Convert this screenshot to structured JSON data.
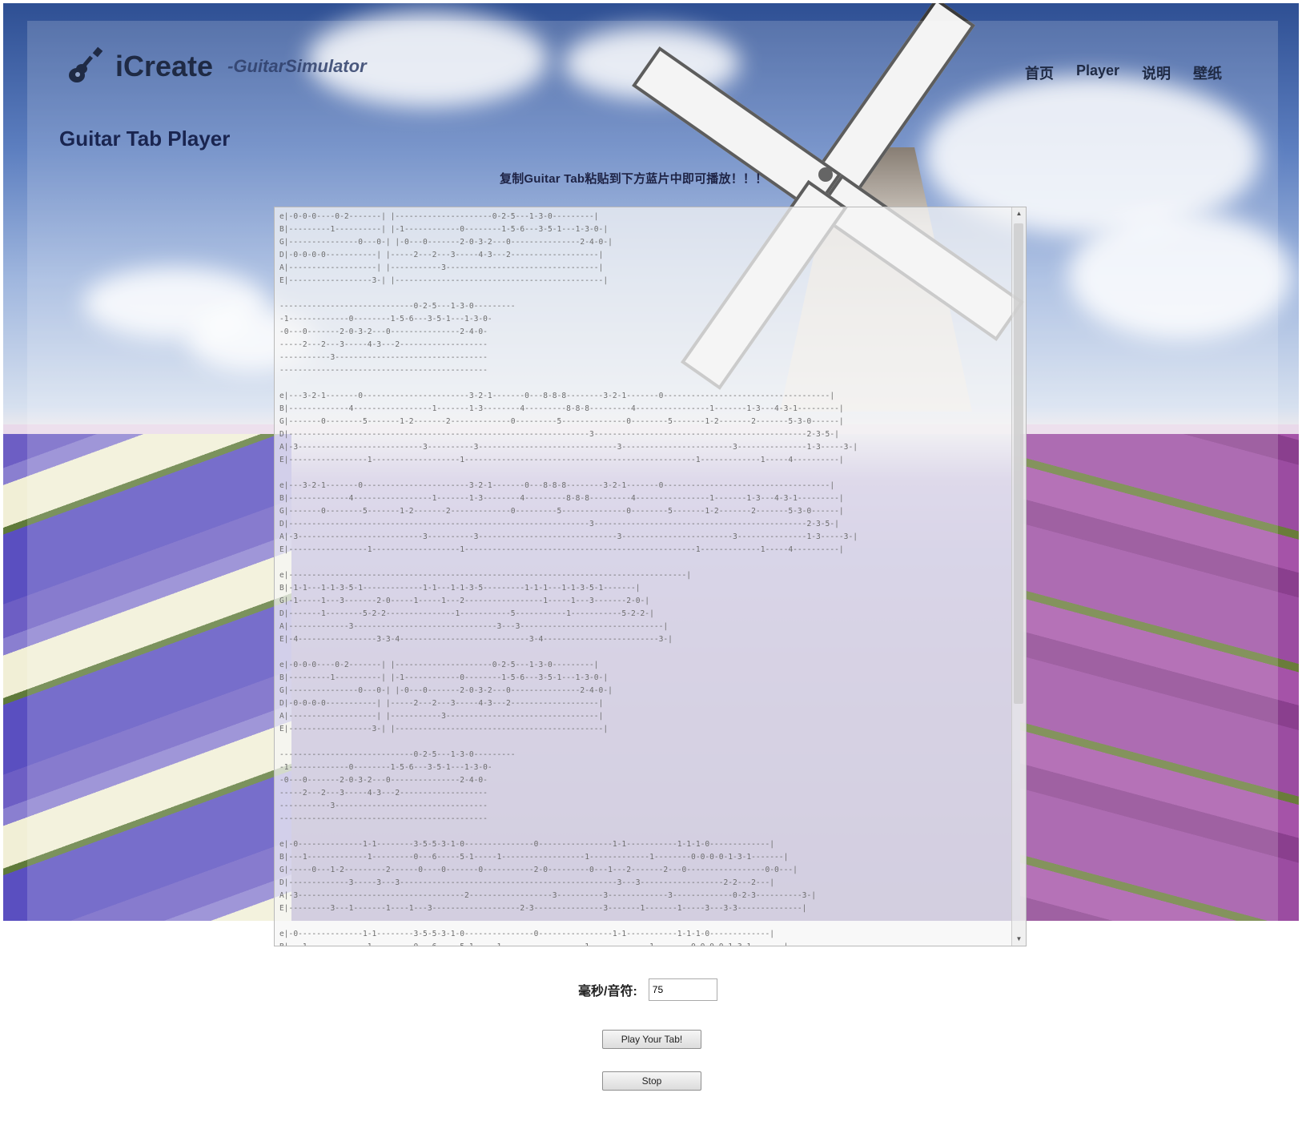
{
  "header": {
    "logo_title": "iCreate",
    "logo_subtitle": "-GuitarSimulator",
    "logo_icon": "guitar-icon"
  },
  "nav": {
    "items": [
      {
        "label": "首页"
      },
      {
        "label": "Player"
      },
      {
        "label": "说明"
      },
      {
        "label": "壁纸"
      }
    ]
  },
  "main": {
    "page_title": "Guitar Tab Player",
    "instruction": "复制Guitar Tab粘贴到下方蓝片中即可播放！！！",
    "tab_text": "e|-0-0-0----0-2-------| |---------------------0-2-5---1-3-0---------|\nB|---------1----------| |-1------------0--------1-5-6---3-5-1---1-3-0-|\nG|---------------0---0-| |-0---0-------2-0-3-2---0---------------2-4-0-|\nD|-0-0-0-0-----------| |-----2---2---3-----4-3---2-------------------|\nA|-------------------| |-----------3---------------------------------|\nE|------------------3-| |---------------------------------------------|\n\n-----------------------------0-2-5---1-3-0---------\n-1-------------0--------1-5-6---3-5-1---1-3-0-\n-0---0-------2-0-3-2---0---------------2-4-0-\n-----2---2---3-----4-3---2-------------------\n-----------3---------------------------------\n---------------------------------------------\n\ne|---3-2-1-------0-----------------------3-2-1-------0---8-8-8--------3-2-1-------0------------------------------------|\nB|-------------4-----------------1-------1-3--------4---------8-8-8---------4----------------1-------1-3---4-3-1---------|\nG|-------0--------5-------1-2-------2-------------0---------5--------------0--------5-------1-2-------2-------5-3-0------|\nD|-----------------------------------------------------------------3----------------------------------------------2-3-5-|\nA|-3---------------------------3----------3------------------------------3------------------------3---------------1-3-----3-|\nE|-----------------1-------------------1--------------------------------------------------1-------------1-----4----------|\n\ne|---3-2-1-------0-----------------------3-2-1-------0---8-8-8--------3-2-1-------0------------------------------------|\nB|-------------4-----------------1-------1-3--------4---------8-8-8---------4----------------1-------1-3---4-3-1---------|\nG|-------0--------5-------1-2-------2-------------0---------5--------------0--------5-------1-2-------2-------5-3-0------|\nD|-----------------------------------------------------------------3----------------------------------------------2-3-5-|\nA|-3---------------------------3----------3------------------------------3------------------------3---------------1-3-----3-|\nE|-----------------1-------------------1--------------------------------------------------1-------------1-----4----------|\n\ne|--------------------------------------------------------------------------------------|\nB|-1-1---1-1-3-5-1-------------1-1---1-1-3-5---------1-1-1---1-1-3-5-1-------|\nG|-1-----1---3-------2-0-----1-----1---2-----------------1-----1---3-------2-0-|\nD|-------1--------5-2-2---------------1-----------5-----------1-----------5-2-2-|\nA|-------------3-------------------------------3---3-------------------------------|\nE|-4-----------------3-3-4----------------------------3-4-------------------------3-|\n\ne|-0-0-0----0-2-------| |---------------------0-2-5---1-3-0---------|\nB|---------1----------| |-1------------0--------1-5-6---3-5-1---1-3-0-|\nG|---------------0---0-| |-0---0-------2-0-3-2---0---------------2-4-0-|\nD|-0-0-0-0-----------| |-----2---2---3-----4-3---2-------------------|\nA|-------------------| |-----------3---------------------------------|\nE|------------------3-| |---------------------------------------------|\n\n-----------------------------0-2-5---1-3-0---------\n-1-------------0--------1-5-6---3-5-1---1-3-0-\n-0---0-------2-0-3-2---0---------------2-4-0-\n-----2---2---3-----4-3---2-------------------\n-----------3---------------------------------\n---------------------------------------------\n\ne|-0--------------1-1--------3-5-5-3-1-0---------------0----------------1-1-----------1-1-1-0-------------|\nB|---1-------------1---------0---6-----5-1-----1------------------1-------------1--------0-0-0-0-1-3-1-------|\nG|-----0---1-2---------2------0----0-------0-----------2-0---------0---1---2-------2---0-----------------0-0---|\nD|-------------3-----3---3-----------------------------------------------3---3------------------2-2---2---|\nA|-3------------------------------------2------------------3----------3-------------3-------------0-2-3----------3-|\nE|---------3---1-------1----1---3-------------------2-3---------------3-------1-------1-----3---3-3--------------|\n\ne|-0--------------1-1--------3-5-5-3-1-0---------------0----------------1-1-----------1-1-1-0-------------|\nB|---1-------------1---------0---6-----5-1-----1------------------1-------------1--------0-0-0-0-1-3-1-------|"
  },
  "controls": {
    "speed_label": "毫秒/音符:",
    "speed_value": "75",
    "play_label": "Play Your Tab!",
    "stop_label": "Stop"
  }
}
